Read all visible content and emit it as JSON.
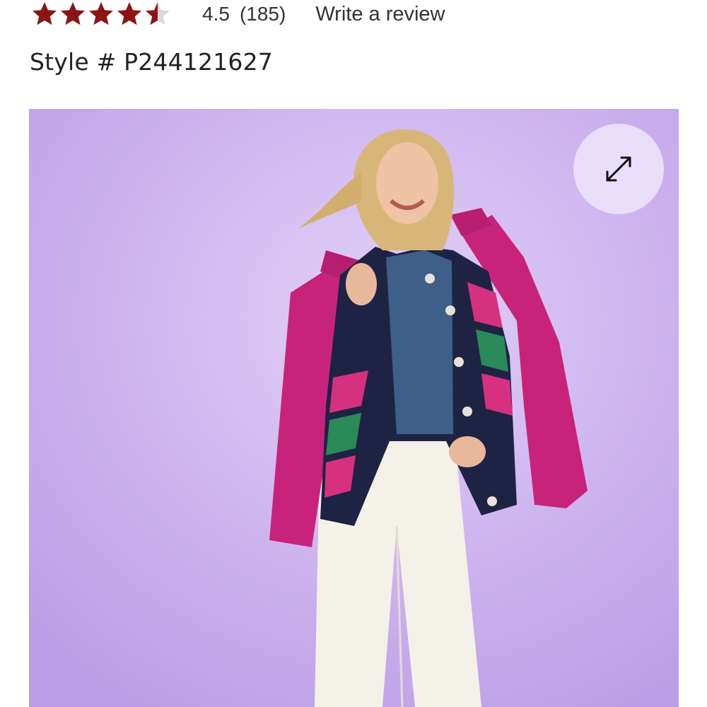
{
  "rating": {
    "stars_filled": 4.5,
    "stars_total": 5,
    "value_label": "4.5",
    "count_label": "(185)",
    "write_review_label": "Write a review",
    "star_color": "#8b1515",
    "star_empty_color": "#d9d9d9"
  },
  "product": {
    "style_label": "Style # P244121627",
    "image_background": "#cdb3ef"
  },
  "icons": {
    "expand": "expand-arrows-icon",
    "star": "star-icon"
  }
}
